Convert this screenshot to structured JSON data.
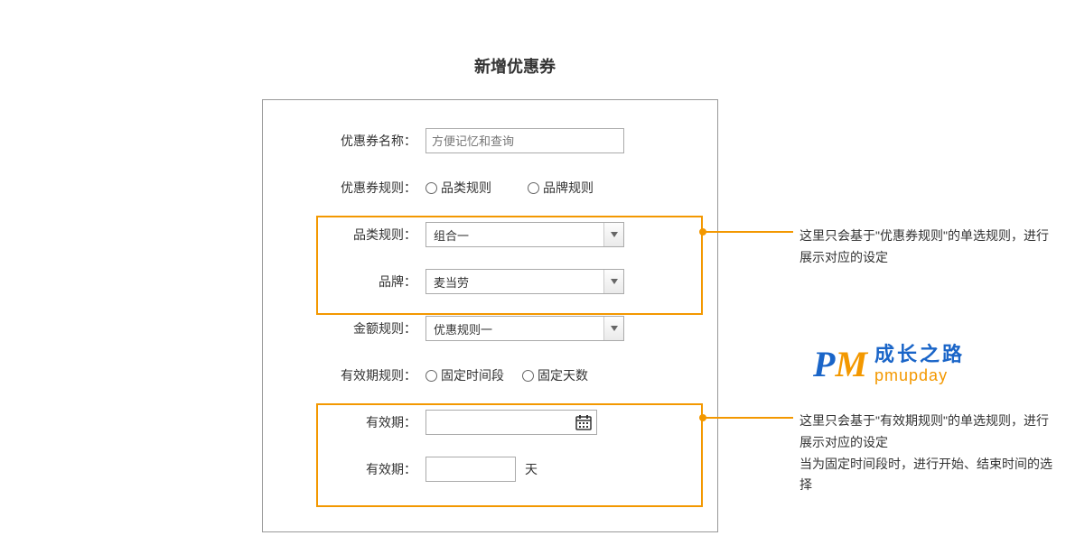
{
  "title": "新增优惠券",
  "form": {
    "coupon_name": {
      "label": "优惠券名称：",
      "placeholder": "方便记忆和查询"
    },
    "coupon_rule": {
      "label": "优惠券规则：",
      "opt1": "品类规则",
      "opt2": "品牌规则"
    },
    "category_rule": {
      "label": "品类规则：",
      "selected": "组合一"
    },
    "brand": {
      "label": "品牌：",
      "selected": "麦当劳"
    },
    "amount_rule": {
      "label": "金额规则：",
      "selected": "优惠规则一"
    },
    "validity_rule": {
      "label": "有效期规则：",
      "opt1": "固定时间段",
      "opt2": "固定天数"
    },
    "validity_date": {
      "label": "有效期："
    },
    "validity_days": {
      "label": "有效期：",
      "unit": "天"
    }
  },
  "annotations": {
    "a1": "这里只会基于\"优惠券规则\"的单选规则，进行展示对应的设定",
    "a2": "这里只会基于\"有效期规则\"的单选规则，进行展示对应的设定\n当为固定时间段时，进行开始、结束时间的选择"
  },
  "watermark": {
    "cn": "成长之路",
    "en": "pmupday"
  }
}
